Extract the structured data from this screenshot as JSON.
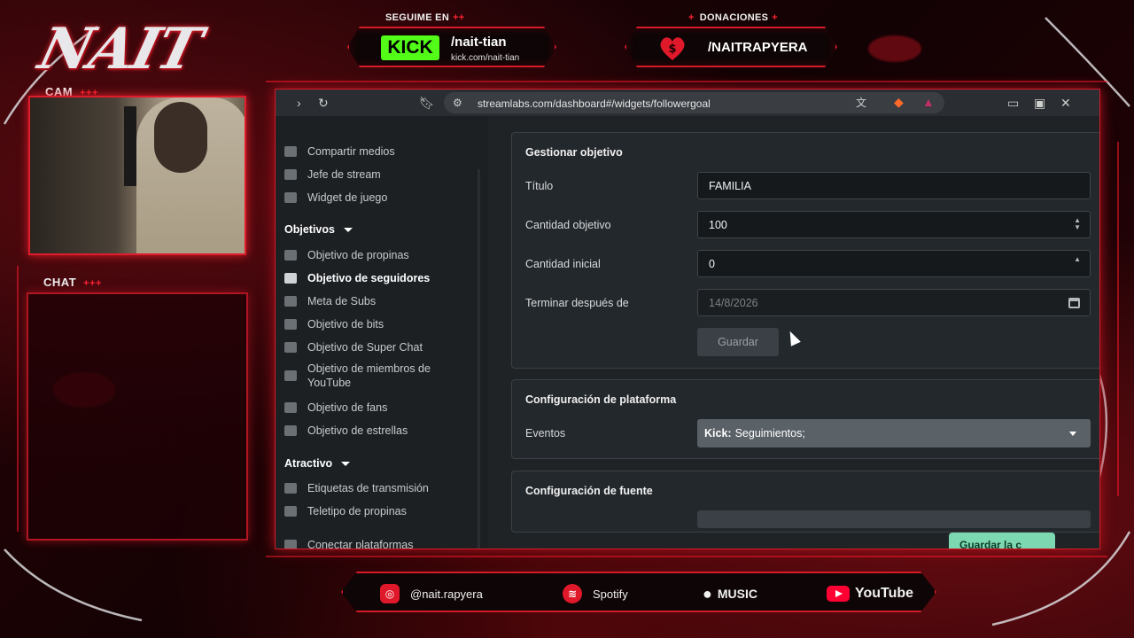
{
  "overlay": {
    "logo_text": "NAIT",
    "follow_label": "SEGUIME EN",
    "follow_plus": "++",
    "kick_badge": "KICK",
    "kick_user": "/nait-tian",
    "kick_url": "kick.com/nait-tian",
    "donations_label": "DONACIONES",
    "donations_plus": "+",
    "donations_user": "/NAITRAPYERA",
    "cam_label": "CAM",
    "cam_plus": "+++",
    "chat_label": "CHAT",
    "chat_plus": "+++",
    "social": {
      "instagram": "@nait.rapyera",
      "spotify": "Spotify",
      "music": "MUSIC",
      "youtube": "YouTube"
    },
    "accent": "#d51a28"
  },
  "browser": {
    "url": "streamlabs.com/dashboard#/widgets/followergoal"
  },
  "sidebar": {
    "items_top": [
      {
        "label": "Compartir medios"
      },
      {
        "label": "Jefe de stream"
      },
      {
        "label": "Widget de juego"
      }
    ],
    "section_goals": "Objetivos",
    "goals": [
      {
        "label": "Objetivo de propinas"
      },
      {
        "label": "Objetivo de seguidores"
      },
      {
        "label": "Meta de Subs"
      },
      {
        "label": "Objetivo de bits"
      },
      {
        "label": "Objetivo de Super Chat"
      },
      {
        "label": "Objetivo de miembros de YouTube"
      },
      {
        "label": "Objetivo de fans"
      },
      {
        "label": "Objetivo de estrellas"
      }
    ],
    "section_attractive": "Atractivo",
    "attractive": [
      {
        "label": "Etiquetas de transmisión"
      },
      {
        "label": "Teletipo de propinas"
      },
      {
        "label": "Conectar plataformas"
      }
    ]
  },
  "goal_form": {
    "title": "Gestionar objetivo",
    "fields": {
      "title_label": "Título",
      "title_value": "FAMILIA",
      "target_label": "Cantidad objetivo",
      "target_value": "100",
      "start_label": "Cantidad inicial",
      "start_value": "0",
      "end_label": "Terminar después de",
      "end_value": "14/8/2026"
    },
    "save": "Guardar"
  },
  "platform": {
    "title": "Configuración de plataforma",
    "events_label": "Eventos",
    "events_platform": "Kick:",
    "events_value": "Seguimientos;"
  },
  "font_config": {
    "title": "Configuración de fuente"
  },
  "save_changes": "Guardar la c"
}
